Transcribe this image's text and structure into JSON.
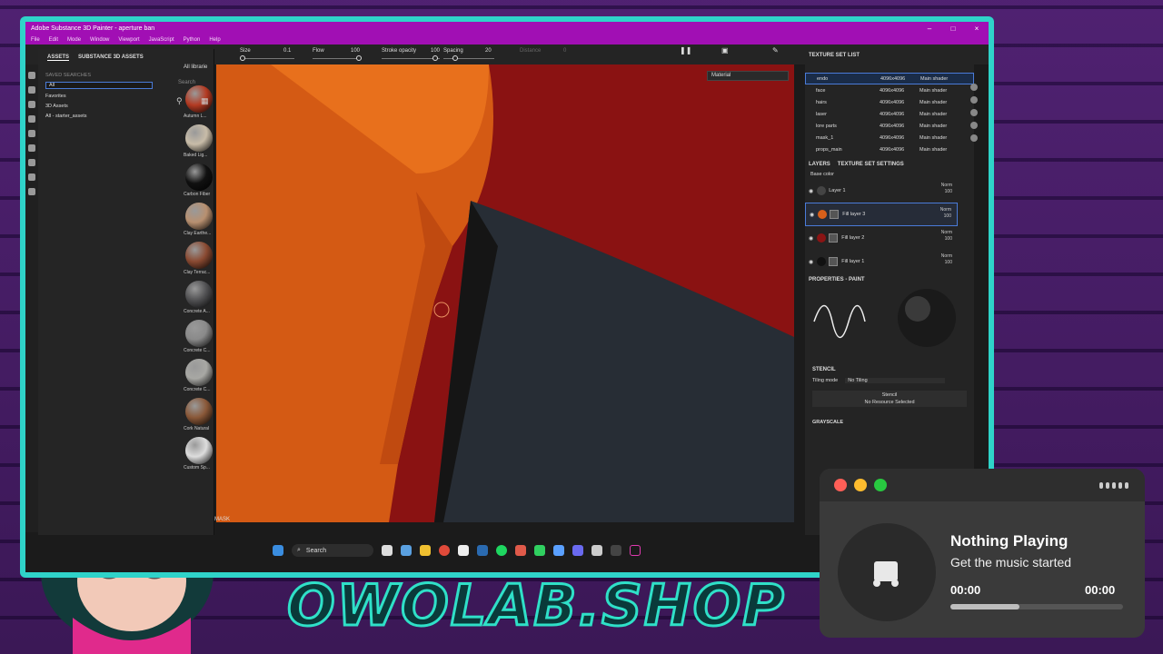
{
  "window": {
    "title": "Adobe Substance 3D Painter - aperture ban",
    "controls": [
      "–",
      "□",
      "×"
    ]
  },
  "menu": [
    "File",
    "Edit",
    "Mode",
    "Window",
    "Viewport",
    "JavaScript",
    "Python",
    "Help"
  ],
  "toolbar": {
    "size_label": "Size",
    "size_value": "0.1",
    "flow_label": "Flow",
    "flow_value": "100",
    "stroke_opacity_label": "Stroke opacity",
    "stroke_opacity_value": "100",
    "spacing_label": "Spacing",
    "spacing_value": "20",
    "distance_label": "Distance",
    "distance_value": "0"
  },
  "assets": {
    "tabs": [
      "ASSETS",
      "SUBSTANCE 3D ASSETS"
    ],
    "saved_searches": "SAVED SEARCHES",
    "search_value": "All",
    "all_libraries": "All librarie",
    "search_placeholder": "Search",
    "sidebar": [
      "Favorites",
      "3D Assets",
      "All - starter_assets"
    ],
    "materials": [
      {
        "name": "Autumn L...",
        "color": "#b33a22"
      },
      {
        "name": "Baked Lig...",
        "color": "#c8bca8"
      },
      {
        "name": "Carbon Fiber",
        "color": "#111111"
      },
      {
        "name": "Clay Earthe...",
        "color": "#b89070"
      },
      {
        "name": "Clay Terrac...",
        "color": "#8a4a32"
      },
      {
        "name": "Concrete A...",
        "color": "#505052"
      },
      {
        "name": "Concrete C...",
        "color": "#8a8a8a"
      },
      {
        "name": "Concrete C...",
        "color": "#a8a8a4"
      },
      {
        "name": "Cork Natural",
        "color": "#8a5838"
      },
      {
        "name": "Custom Sp...",
        "color": "#dddddd"
      }
    ],
    "mask_label": "MASK"
  },
  "viewport": {
    "material_select": "Material"
  },
  "texture_set_list": {
    "title": "TEXTURE SET LIST",
    "rows": [
      {
        "name": "endo",
        "res": "4096x4096",
        "shader": "Main shader",
        "selected": true
      },
      {
        "name": "face",
        "res": "4096x4096",
        "shader": "Main shader"
      },
      {
        "name": "hairs",
        "res": "4096x4096",
        "shader": "Main shader"
      },
      {
        "name": "laser",
        "res": "4096x4096",
        "shader": "Main shader"
      },
      {
        "name": "lore parts",
        "res": "4096x4096",
        "shader": "Main shader"
      },
      {
        "name": "mask_1",
        "res": "4096x4096",
        "shader": "Main shader"
      },
      {
        "name": "props_main",
        "res": "4096x4096",
        "shader": "Main shader"
      }
    ]
  },
  "layers": {
    "tabs": [
      "LAYERS",
      "TEXTURE SET SETTINGS"
    ],
    "channel": "Base color",
    "items": [
      {
        "name": "Layer 1",
        "blend": "Norm",
        "opacity": "100",
        "color": "#444444"
      },
      {
        "name": "Fill layer 3",
        "blend": "Norm",
        "opacity": "100",
        "color": "#d8601a",
        "selected": true
      },
      {
        "name": "Fill layer 2",
        "blend": "Norm",
        "opacity": "100",
        "color": "#8a1414"
      },
      {
        "name": "Fill layer 1",
        "blend": "Norm",
        "opacity": "100",
        "color": "#111111"
      }
    ]
  },
  "properties": {
    "title": "PROPERTIES - PAINT",
    "stencil": "STENCIL",
    "tiling_label": "Tiling mode",
    "tiling_value": "No Tiling",
    "stencil_btn": "Stencil",
    "no_resource": "No Resource Selected",
    "grayscale": "GRAYSCALE"
  },
  "taskbar": {
    "search": "Search"
  },
  "music": {
    "title": "Nothing Playing",
    "subtitle": "Get the music started",
    "time_start": "00:00",
    "time_end": "00:00",
    "progress": 0.4
  },
  "brand": "OWOLAB.SHOP"
}
